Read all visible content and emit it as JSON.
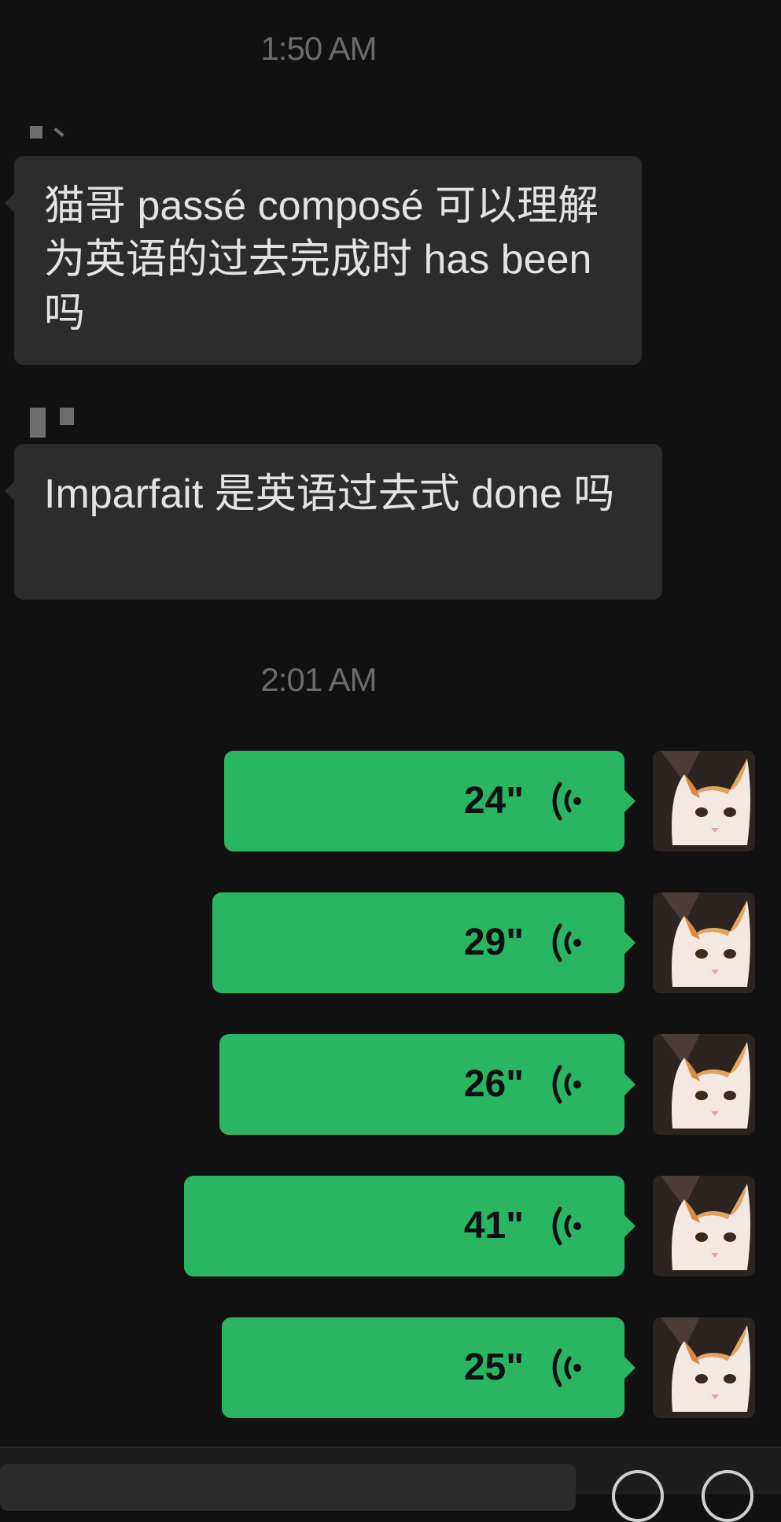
{
  "chat": {
    "timestamps": [
      "1:50 AM",
      "2:01 AM"
    ],
    "incoming": [
      {
        "text": "猫哥 passé composé 可以理解为英语的过去完成时 has been吗"
      },
      {
        "text": "Imparfait 是英语过去式  done 吗"
      }
    ],
    "outgoing_voice": [
      {
        "duration": "24\""
      },
      {
        "duration": "29\""
      },
      {
        "duration": "26\""
      },
      {
        "duration": "41\""
      },
      {
        "duration": "25\""
      }
    ]
  },
  "icons": {
    "voice": "voice-wave-icon",
    "avatar": "cat-avatar"
  },
  "colors": {
    "background": "#111111",
    "incoming_bubble": "#2c2c2c",
    "outgoing_bubble": "#29b562",
    "timestamp": "#6b6b6b"
  }
}
